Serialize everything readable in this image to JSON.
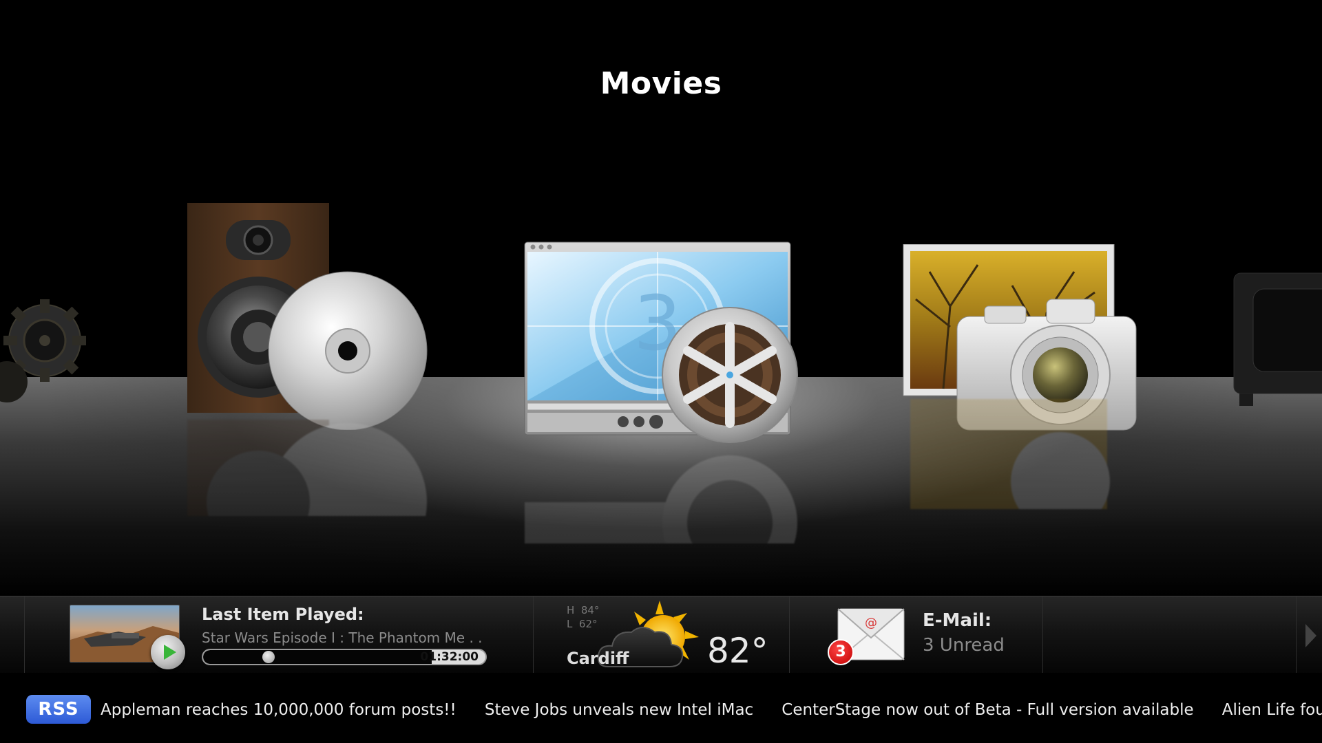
{
  "menu": {
    "title": "Movies",
    "items": [
      {
        "name": "gear-icon"
      },
      {
        "name": "speaker-cd-icon"
      },
      {
        "name": "movie-player-reel-icon"
      },
      {
        "name": "photo-camera-icon"
      },
      {
        "name": "television-icon"
      }
    ]
  },
  "now_playing": {
    "label": "Last Item Played:",
    "title": "Star Wars Episode I : The Phantom Me . .",
    "time": "01:32:00",
    "progress": 0.26
  },
  "weather": {
    "high_label": "H",
    "high": "84°",
    "low_label": "L",
    "low": "62°",
    "city": "Cardiff",
    "temp": "82°",
    "icon": "partly-cloudy-icon"
  },
  "email": {
    "label": "E-Mail:",
    "unread": "3 Unread",
    "badge": "3",
    "icon": "envelope-icon"
  },
  "rss": {
    "badge": "RSS",
    "items": [
      "Appleman reaches 10,000,000 forum posts!!",
      "Steve Jobs unveals new Intel iMac",
      "CenterStage now out of Beta - Full version available",
      "Alien Life found on Sa"
    ]
  },
  "colors": {
    "play_green": "#39b539",
    "rss_blue": "#3a66dd",
    "badge_red": "#d81010"
  }
}
